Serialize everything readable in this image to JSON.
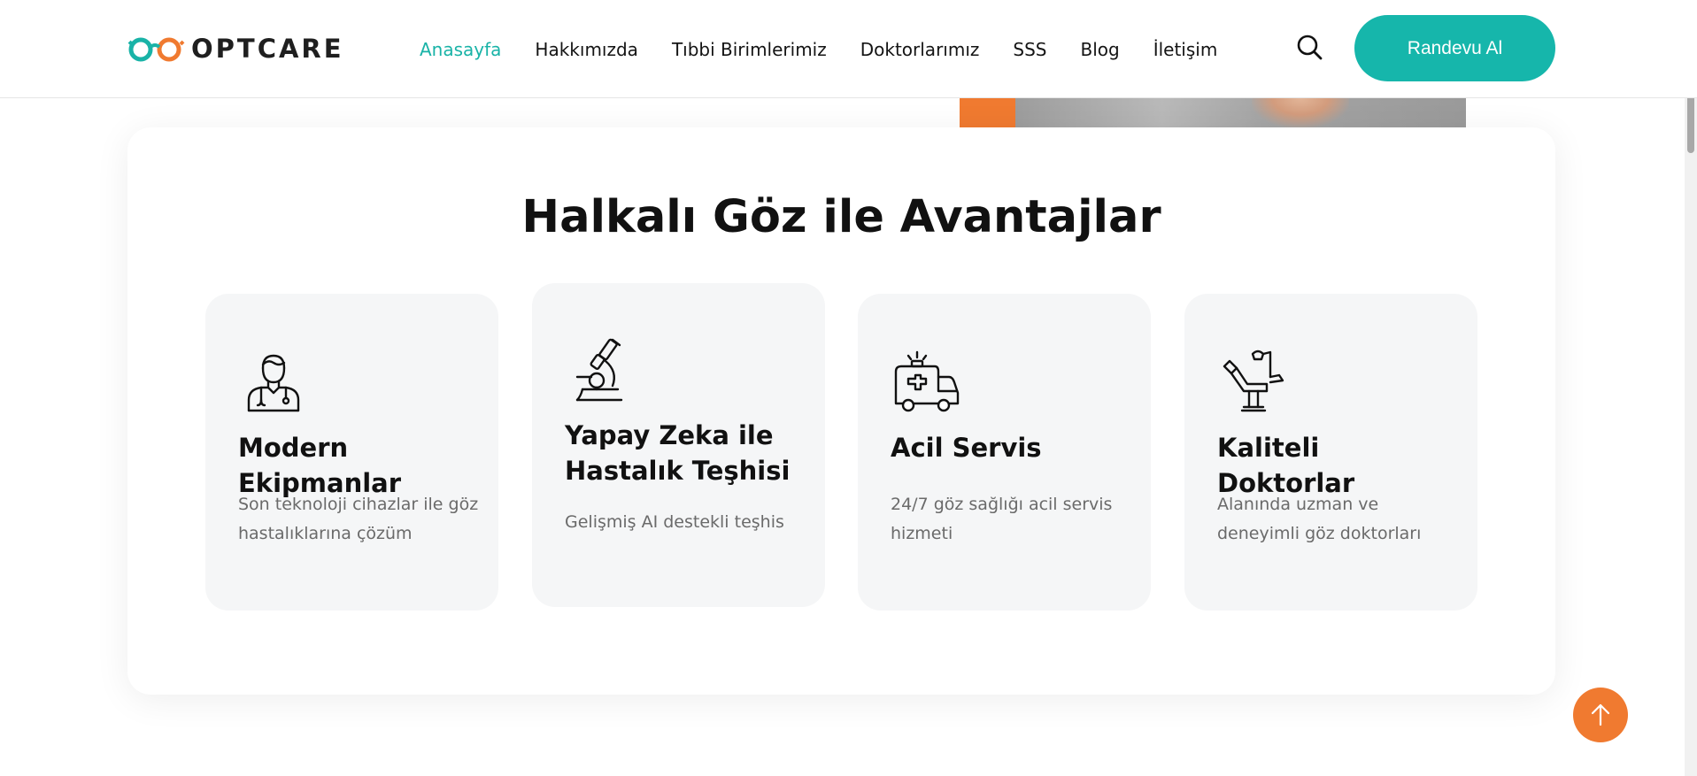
{
  "brand": {
    "name": "OPTCARE",
    "teal": "#19b3a7",
    "orange": "#f07a30"
  },
  "nav": {
    "items": [
      {
        "label": "Anasayfa",
        "active": true
      },
      {
        "label": "Hakkımızda"
      },
      {
        "label": "Tıbbi Birimlerimiz"
      },
      {
        "label": "Doktorlarımız"
      },
      {
        "label": "SSS"
      },
      {
        "label": "Blog"
      },
      {
        "label": "İletişim"
      }
    ]
  },
  "header": {
    "search_icon": "search-icon",
    "cta_label": "Randevu Al"
  },
  "section": {
    "title": "Halkalı Göz ile Avantajlar",
    "features": [
      {
        "icon": "doctor-icon",
        "title": "Modern Ekipmanlar",
        "desc": "Son teknoloji cihazlar ile göz hastalıklarına çözüm"
      },
      {
        "icon": "microscope-icon",
        "title": "Yapay Zeka ile Hastalık Teşhisi",
        "desc": "Gelişmiş AI destekli teşhis"
      },
      {
        "icon": "ambulance-icon",
        "title": "Acil Servis",
        "desc": "24/7 göz sağlığı acil servis hizmeti"
      },
      {
        "icon": "exam-chair-icon",
        "title": "Kaliteli Doktorlar",
        "desc": "Alanında uzman ve deneyimli göz doktorları"
      }
    ]
  },
  "scroll_top": {
    "icon": "arrow-up-icon"
  }
}
